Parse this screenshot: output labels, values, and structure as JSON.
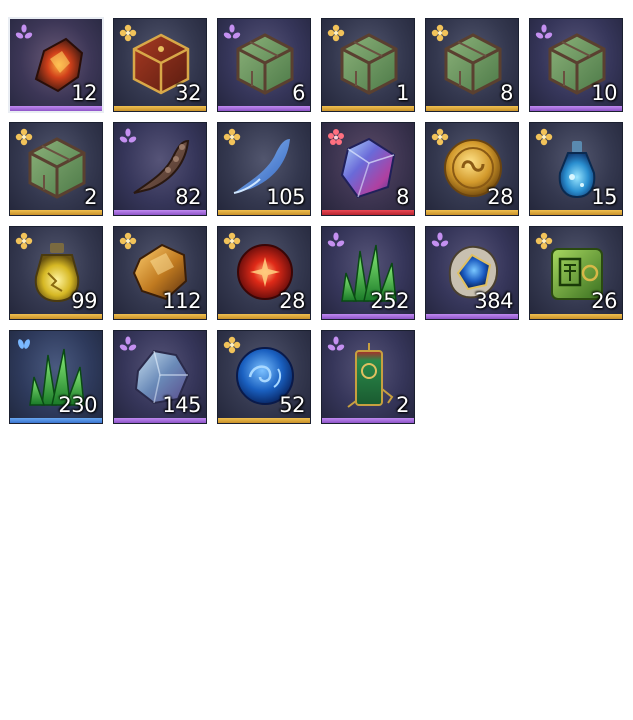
{
  "inventory": {
    "slots": [
      {
        "icon": "ember-ore-icon",
        "rarity": "purple",
        "quantity": "12",
        "selected": true
      },
      {
        "icon": "red-mahjong-cube-icon",
        "rarity": "gold",
        "quantity": "32"
      },
      {
        "icon": "jade-cube-icon",
        "rarity": "purple",
        "quantity": "6"
      },
      {
        "icon": "jade-cube-icon",
        "rarity": "gold",
        "quantity": "1"
      },
      {
        "icon": "jade-cube-icon",
        "rarity": "gold",
        "quantity": "8"
      },
      {
        "icon": "jade-cube-icon",
        "rarity": "purple",
        "quantity": "10"
      },
      {
        "icon": "jade-cube-icon",
        "rarity": "gold",
        "quantity": "2"
      },
      {
        "icon": "bone-claw-icon",
        "rarity": "purple",
        "quantity": "82"
      },
      {
        "icon": "blue-spirit-claw-icon",
        "rarity": "gold",
        "quantity": "105"
      },
      {
        "icon": "prism-crystal-icon",
        "rarity": "red",
        "quantity": "8"
      },
      {
        "icon": "gold-coin-icon",
        "rarity": "gold",
        "quantity": "28"
      },
      {
        "icon": "blue-potion-icon",
        "rarity": "gold",
        "quantity": "15"
      },
      {
        "icon": "yellow-potion-icon",
        "rarity": "gold",
        "quantity": "99"
      },
      {
        "icon": "amber-stone-icon",
        "rarity": "gold",
        "quantity": "112"
      },
      {
        "icon": "red-orb-icon",
        "rarity": "gold",
        "quantity": "28"
      },
      {
        "icon": "green-crystal-cluster-icon",
        "rarity": "purple",
        "quantity": "252"
      },
      {
        "icon": "sapphire-skull-icon",
        "rarity": "purple",
        "quantity": "384"
      },
      {
        "icon": "jade-seal-box-icon",
        "rarity": "gold",
        "quantity": "26"
      },
      {
        "icon": "green-crystal-cluster-icon",
        "rarity": "blue",
        "quantity": "230"
      },
      {
        "icon": "blue-mineral-icon",
        "rarity": "purple",
        "quantity": "145"
      },
      {
        "icon": "blue-swirl-orb-icon",
        "rarity": "gold",
        "quantity": "52"
      },
      {
        "icon": "jade-talisman-icon",
        "rarity": "purple",
        "quantity": "2"
      }
    ]
  },
  "colors": {
    "gold": "#e0b040",
    "purple": "#b080e8",
    "red": "#e04050",
    "blue": "#5b9ae8"
  }
}
